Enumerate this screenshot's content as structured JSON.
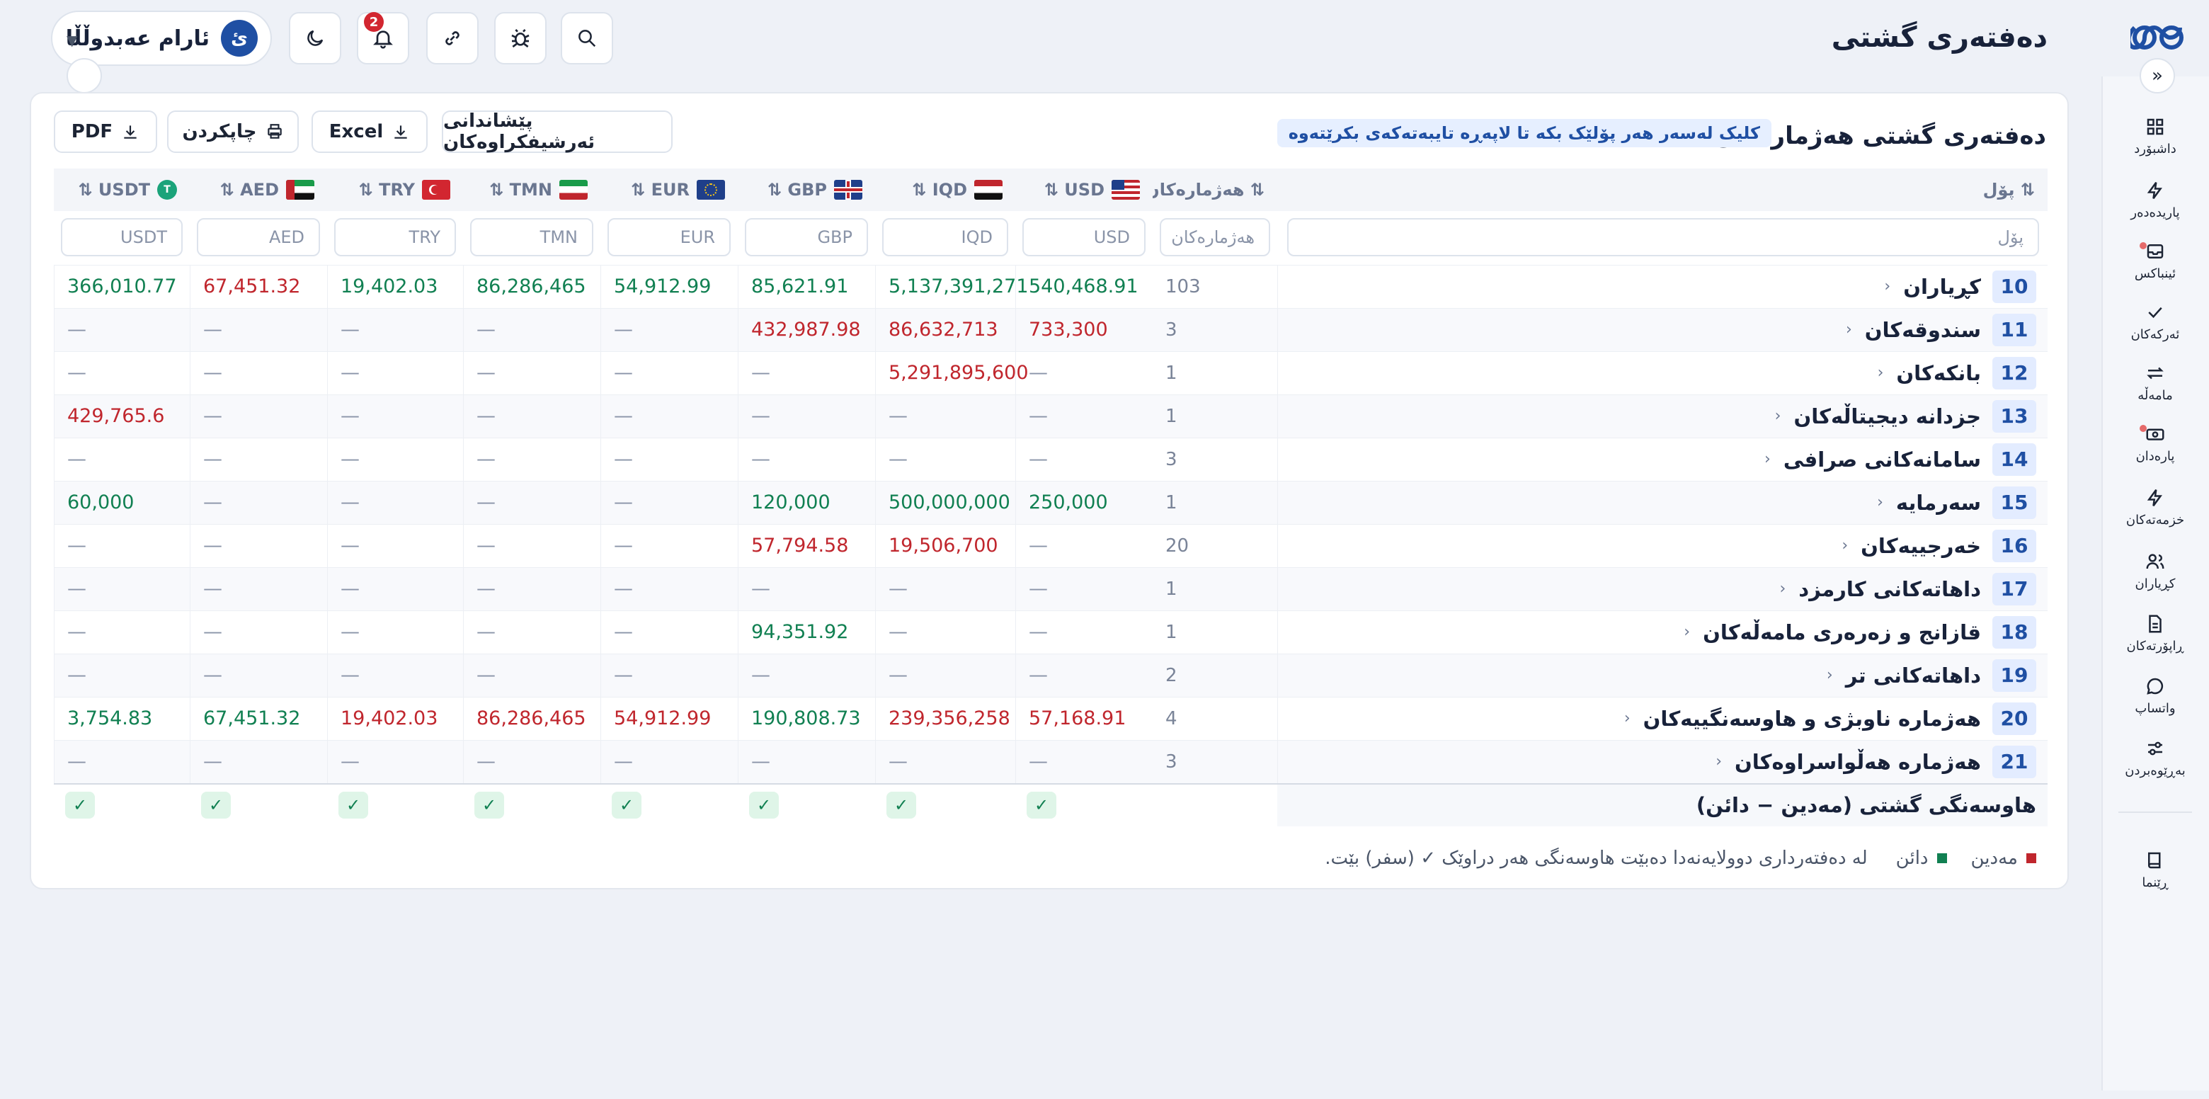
{
  "header": {
    "page_title": "دەفتەری گشتی",
    "help": "؟",
    "notifications_count": "2",
    "user_initial": "ئ",
    "user_name": "ئارام عەبدوڵڵا"
  },
  "sidebar": {
    "items": [
      {
        "label": "داشبۆرد",
        "icon": "grid-icon"
      },
      {
        "label": "پاریدەدەر",
        "icon": "bolt-icon"
      },
      {
        "label": "ئینباکس",
        "icon": "inbox-icon"
      },
      {
        "label": "ئەرکەکان",
        "icon": "check-icon"
      },
      {
        "label": "مامەڵە",
        "icon": "swap-icon"
      },
      {
        "label": "پارەدان",
        "icon": "cash-icon"
      },
      {
        "label": "خزمەتەکان",
        "icon": "bolt-icon"
      },
      {
        "label": "کڕیاران",
        "icon": "users-icon"
      },
      {
        "label": "ڕاپۆرتەکان",
        "icon": "document-icon"
      },
      {
        "label": "واتساپ",
        "icon": "chat-icon"
      },
      {
        "label": "بەڕێوەبردن",
        "icon": "sliders-icon"
      },
      {
        "label": "ڕێنما",
        "icon": "book-icon"
      }
    ]
  },
  "card": {
    "title": "دەفتەری گشتی هەژمارەکان",
    "hint": "کلیک لەسەر هەر پۆلێک بکە تا لاپەڕە تایبەتەکەی بکرێتەوە",
    "buttons": {
      "suggest": "پێشاندانی ئەرشیفکراوەکان",
      "excel": "Excel",
      "print": "چاپکردن",
      "pdf": "PDF"
    }
  },
  "table": {
    "headers": {
      "class": "پۆل",
      "accounts": "هەژمارەکان",
      "currencies": [
        "USD",
        "IQD",
        "GBP",
        "EUR",
        "TMN",
        "TRY",
        "AED",
        "USDT"
      ]
    },
    "filters": {
      "class": "پۆل",
      "accounts": "هەژمارەکان",
      "currencies": [
        "USD",
        "IQD",
        "GBP",
        "EUR",
        "TMN",
        "TRY",
        "AED",
        "USDT"
      ]
    },
    "rows": [
      {
        "num": "10",
        "name": "کڕیاران",
        "count": "103",
        "vals": [
          [
            "540,468.91",
            "pos"
          ],
          [
            "5,137,391,271",
            "pos"
          ],
          [
            "85,621.91",
            "pos"
          ],
          [
            "54,912.99",
            "pos"
          ],
          [
            "86,286,465",
            "pos"
          ],
          [
            "19,402.03",
            "pos"
          ],
          [
            "67,451.32",
            "neg"
          ],
          [
            "366,010.77",
            "pos"
          ]
        ]
      },
      {
        "num": "11",
        "name": "سندوقەکان",
        "count": "3",
        "vals": [
          [
            "733,300",
            "neg"
          ],
          [
            "86,632,713",
            "neg"
          ],
          [
            "432,987.98",
            "neg"
          ],
          [
            "—",
            "zero"
          ],
          [
            "—",
            "zero"
          ],
          [
            "—",
            "zero"
          ],
          [
            "—",
            "zero"
          ],
          [
            "—",
            "zero"
          ]
        ]
      },
      {
        "num": "12",
        "name": "بانکەکان",
        "count": "1",
        "vals": [
          [
            "—",
            "zero"
          ],
          [
            "5,291,895,600",
            "neg"
          ],
          [
            "—",
            "zero"
          ],
          [
            "—",
            "zero"
          ],
          [
            "—",
            "zero"
          ],
          [
            "—",
            "zero"
          ],
          [
            "—",
            "zero"
          ],
          [
            "—",
            "zero"
          ]
        ]
      },
      {
        "num": "13",
        "name": "جزدانە دیجیتاڵەکان",
        "count": "1",
        "vals": [
          [
            "—",
            "zero"
          ],
          [
            "—",
            "zero"
          ],
          [
            "—",
            "zero"
          ],
          [
            "—",
            "zero"
          ],
          [
            "—",
            "zero"
          ],
          [
            "—",
            "zero"
          ],
          [
            "—",
            "zero"
          ],
          [
            "429,765.6",
            "neg"
          ]
        ]
      },
      {
        "num": "14",
        "name": "سامانەکانی صرافی",
        "count": "3",
        "vals": [
          [
            "—",
            "zero"
          ],
          [
            "—",
            "zero"
          ],
          [
            "—",
            "zero"
          ],
          [
            "—",
            "zero"
          ],
          [
            "—",
            "zero"
          ],
          [
            "—",
            "zero"
          ],
          [
            "—",
            "zero"
          ],
          [
            "—",
            "zero"
          ]
        ]
      },
      {
        "num": "15",
        "name": "سەرمایە",
        "count": "1",
        "vals": [
          [
            "250,000",
            "pos"
          ],
          [
            "500,000,000",
            "pos"
          ],
          [
            "120,000",
            "pos"
          ],
          [
            "—",
            "zero"
          ],
          [
            "—",
            "zero"
          ],
          [
            "—",
            "zero"
          ],
          [
            "—",
            "zero"
          ],
          [
            "60,000",
            "pos"
          ]
        ]
      },
      {
        "num": "16",
        "name": "خەرجییەکان",
        "count": "20",
        "vals": [
          [
            "—",
            "zero"
          ],
          [
            "19,506,700",
            "neg"
          ],
          [
            "57,794.58",
            "neg"
          ],
          [
            "—",
            "zero"
          ],
          [
            "—",
            "zero"
          ],
          [
            "—",
            "zero"
          ],
          [
            "—",
            "zero"
          ],
          [
            "—",
            "zero"
          ]
        ]
      },
      {
        "num": "17",
        "name": "داهاتەکانی کارمزد",
        "count": "1",
        "vals": [
          [
            "—",
            "zero"
          ],
          [
            "—",
            "zero"
          ],
          [
            "—",
            "zero"
          ],
          [
            "—",
            "zero"
          ],
          [
            "—",
            "zero"
          ],
          [
            "—",
            "zero"
          ],
          [
            "—",
            "zero"
          ],
          [
            "—",
            "zero"
          ]
        ]
      },
      {
        "num": "18",
        "name": "قازانج و زەرەری مامەڵەکان",
        "count": "1",
        "vals": [
          [
            "—",
            "zero"
          ],
          [
            "—",
            "zero"
          ],
          [
            "94,351.92",
            "pos"
          ],
          [
            "—",
            "zero"
          ],
          [
            "—",
            "zero"
          ],
          [
            "—",
            "zero"
          ],
          [
            "—",
            "zero"
          ],
          [
            "—",
            "zero"
          ]
        ]
      },
      {
        "num": "19",
        "name": "داهاتەکانی تر",
        "count": "2",
        "vals": [
          [
            "—",
            "zero"
          ],
          [
            "—",
            "zero"
          ],
          [
            "—",
            "zero"
          ],
          [
            "—",
            "zero"
          ],
          [
            "—",
            "zero"
          ],
          [
            "—",
            "zero"
          ],
          [
            "—",
            "zero"
          ],
          [
            "—",
            "zero"
          ]
        ]
      },
      {
        "num": "20",
        "name": "هەژمارە ناوبژی و هاوسەنگییەکان",
        "count": "4",
        "vals": [
          [
            "57,168.91",
            "neg"
          ],
          [
            "239,356,258",
            "neg"
          ],
          [
            "190,808.73",
            "pos"
          ],
          [
            "54,912.99",
            "neg"
          ],
          [
            "86,286,465",
            "neg"
          ],
          [
            "19,402.03",
            "neg"
          ],
          [
            "67,451.32",
            "pos"
          ],
          [
            "3,754.83",
            "pos"
          ]
        ]
      },
      {
        "num": "21",
        "name": "هەژمارە هەڵواسراوەکان",
        "count": "3",
        "vals": [
          [
            "—",
            "zero"
          ],
          [
            "—",
            "zero"
          ],
          [
            "—",
            "zero"
          ],
          [
            "—",
            "zero"
          ],
          [
            "—",
            "zero"
          ],
          [
            "—",
            "zero"
          ],
          [
            "—",
            "zero"
          ],
          [
            "—",
            "zero"
          ]
        ]
      }
    ],
    "balance_label": "هاوسەنگی گشتی (مەدین − دائن)",
    "check": "✓"
  },
  "legend": {
    "debit": "مەدین",
    "credit": "دائن",
    "note": "لە دەفتەرداری دوولایەنەدا دەبێت هاوسەنگی هەر دراوێک ✓ (سفر) بێت."
  },
  "colors": {
    "accent": "#1f4fa3",
    "positive": "#118052",
    "negative": "#c0262d"
  }
}
